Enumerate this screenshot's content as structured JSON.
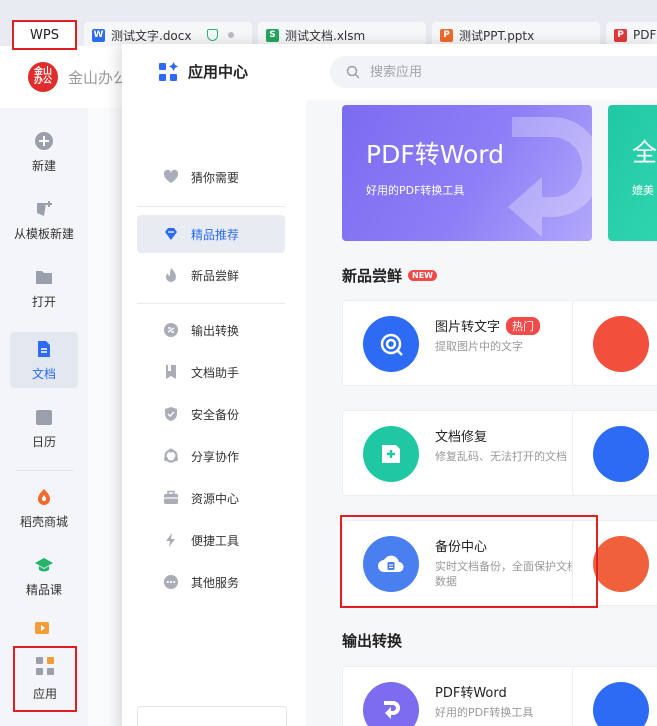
{
  "tabs": {
    "wps": "WPS",
    "items": [
      {
        "label": "测试文字.docx",
        "icon": "W",
        "color": "#2d6bf5"
      },
      {
        "label": "测试文档.xlsm",
        "icon": "S",
        "color": "#25a55f"
      },
      {
        "label": "测试PPT.pptx",
        "icon": "P",
        "color": "#f06a2c"
      },
      {
        "label": "PDF",
        "icon": "P",
        "color": "#e03a3a"
      }
    ]
  },
  "home": {
    "logo_text": "金山\n办公",
    "name": "金山办公"
  },
  "leftnav": {
    "items": [
      {
        "label": "新建"
      },
      {
        "label": "从模板新建"
      },
      {
        "label": "打开"
      },
      {
        "label": "文档"
      },
      {
        "label": "日历",
        "icon_text": "31"
      },
      {
        "label": "稻壳商城"
      },
      {
        "label": "精品课"
      },
      {
        "label": "应用"
      }
    ]
  },
  "appcenter": {
    "title": "应用中心",
    "search_placeholder": "搜索应用",
    "categories": [
      {
        "label": "猜你需要"
      },
      {
        "label": "精品推荐"
      },
      {
        "label": "新品尝鲜"
      },
      {
        "label": "输出转换"
      },
      {
        "label": "文档助手"
      },
      {
        "label": "安全备份"
      },
      {
        "label": "分享协作"
      },
      {
        "label": "资源中心"
      },
      {
        "label": "便捷工具"
      },
      {
        "label": "其他服务"
      }
    ],
    "banners": [
      {
        "title": "PDF转Word",
        "subtitle": "好用的PDF转换工具"
      },
      {
        "title": "全",
        "subtitle": "媲美"
      }
    ],
    "sections": {
      "new": {
        "title": "新品尝鲜",
        "badge": "NEW"
      },
      "output": {
        "title": "输出转换"
      }
    },
    "cards": [
      {
        "name": "图片转文字",
        "badge": "热门",
        "desc": "提取图片中的文字"
      },
      {
        "name": "文档修复",
        "desc": "修复乱码、无法打开的文档"
      },
      {
        "name": "备份中心",
        "desc": "实时文档备份，全面保护文档数据"
      },
      {
        "name": "PDF转Word",
        "desc": "好用的PDF转换工具"
      }
    ],
    "colors": {
      "accent": "#2d6bf5",
      "highlight": "#e02020",
      "hot": "#f24949"
    }
  }
}
